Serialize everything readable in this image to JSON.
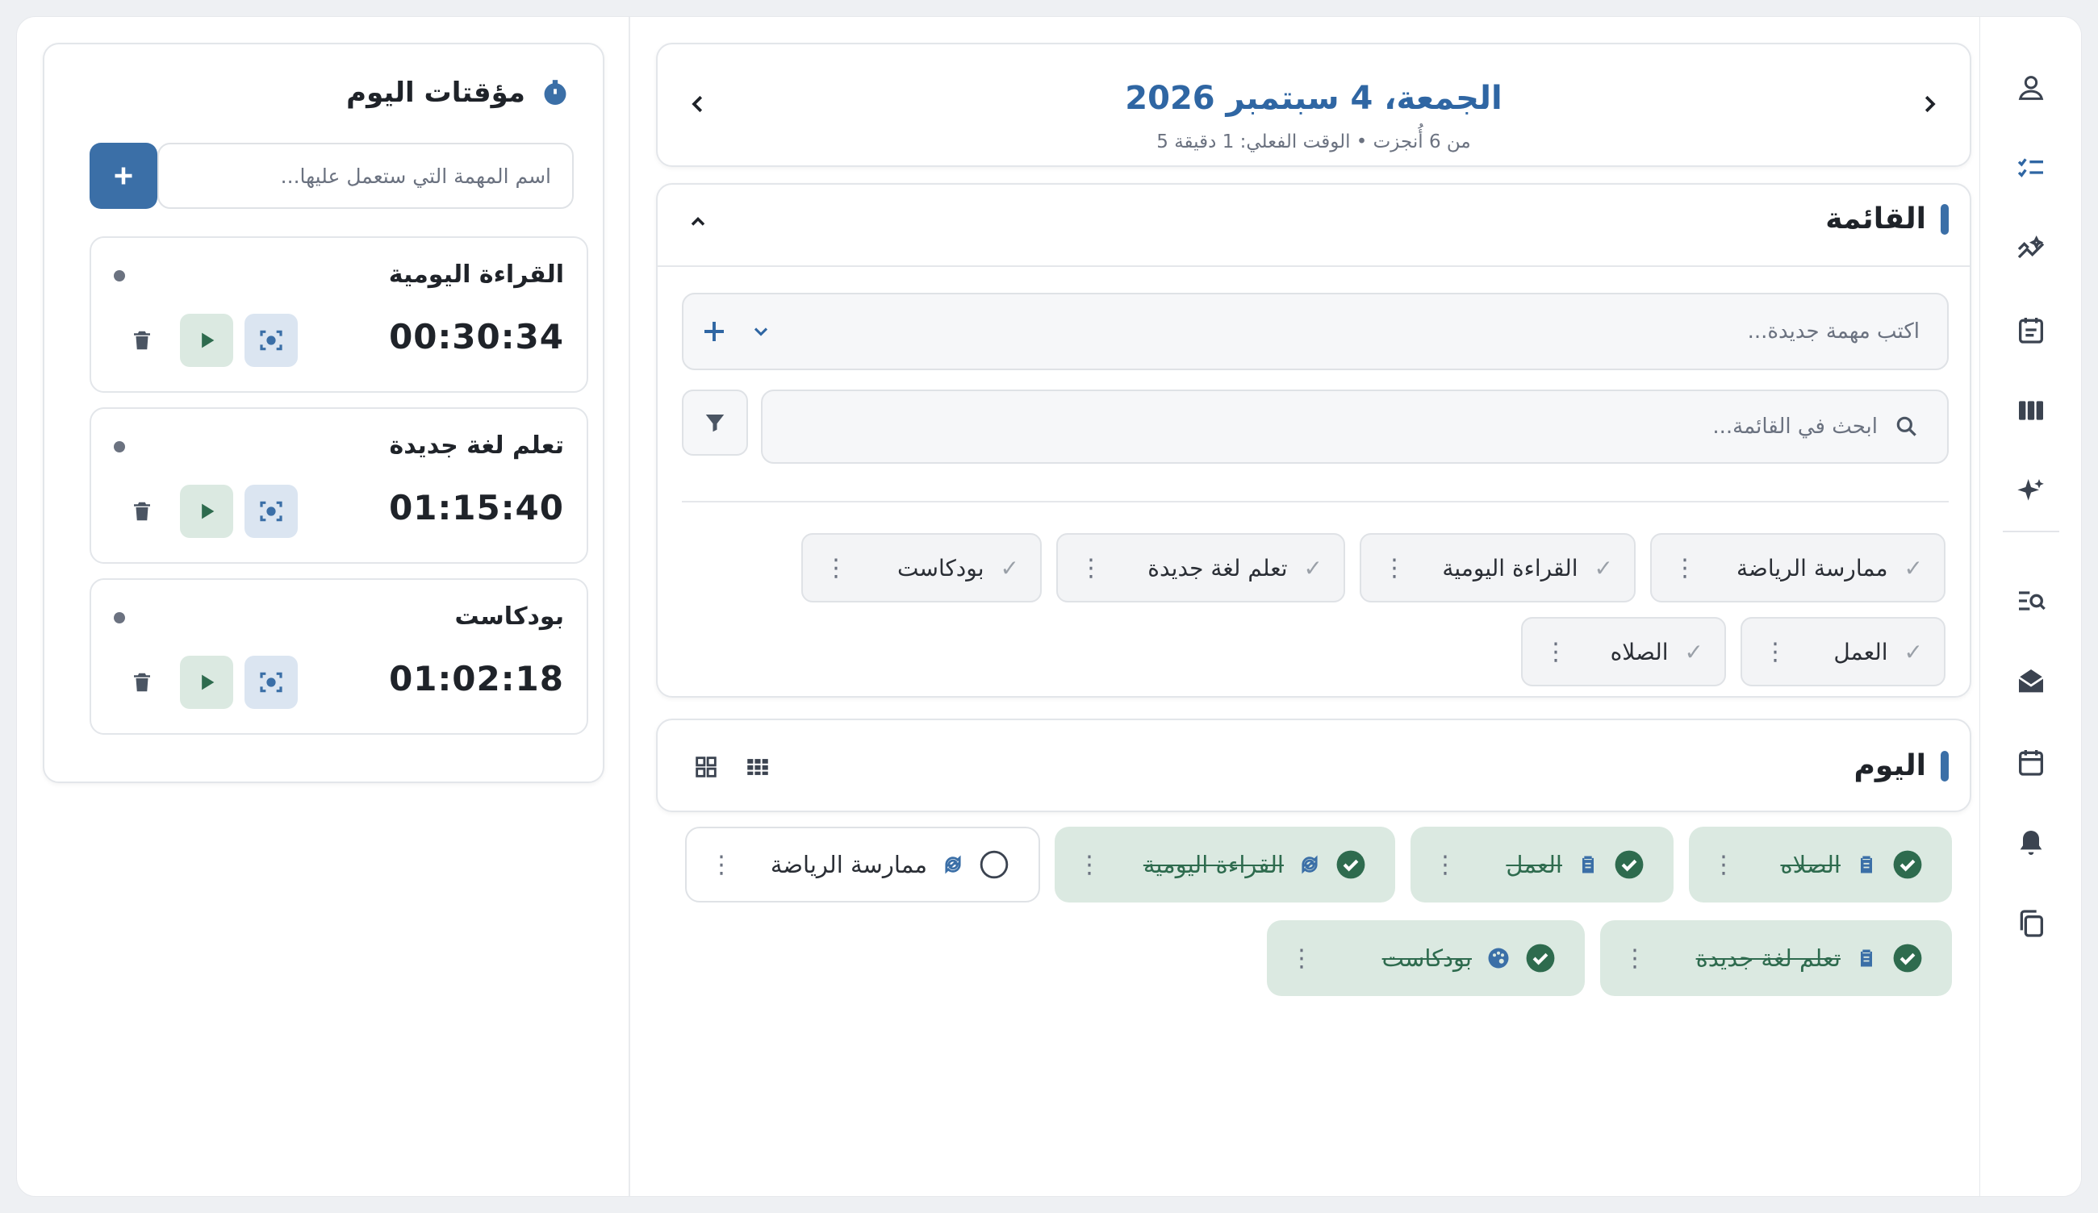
{
  "header": {
    "date_title": "الجمعة، 4 سبتمبر 2026",
    "subtitle": "5 من 6 أُنجزت • الوقت الفعلي: 1 دقيقة"
  },
  "list_section": {
    "title": "القائمة",
    "new_task_placeholder": "اكتب مهمة جديدة...",
    "search_placeholder": "ابحث في القائمة...",
    "chips": [
      {
        "label": "ممارسة الرياضة"
      },
      {
        "label": "القراءة اليومية"
      },
      {
        "label": "تعلم لغة جديدة"
      },
      {
        "label": "بودكاست"
      },
      {
        "label": "العمل"
      },
      {
        "label": "الصلاه"
      }
    ]
  },
  "today_section": {
    "title": "اليوم",
    "tasks": [
      {
        "label": "الصلاه",
        "done": true,
        "icon": "clipboard-icon"
      },
      {
        "label": "العمل",
        "done": true,
        "icon": "clipboard-icon"
      },
      {
        "label": "القراءة اليومية",
        "done": true,
        "icon": "repeat-icon"
      },
      {
        "label": "ممارسة الرياضة",
        "done": false,
        "icon": "repeat-icon"
      },
      {
        "label": "تعلم لغة جديدة",
        "done": true,
        "icon": "clipboard-icon"
      },
      {
        "label": "بودكاست",
        "done": true,
        "icon": "palette-icon"
      }
    ]
  },
  "timers": {
    "title": "مؤقتات اليوم",
    "input_placeholder": "اسم المهمة التي ستعمل عليها...",
    "items": [
      {
        "name": "القراءة اليومية",
        "time": "00:30:34"
      },
      {
        "name": "تعلم لغة جديدة",
        "time": "01:15:40"
      },
      {
        "name": "بودكاست",
        "time": "01:02:18"
      }
    ]
  },
  "colors": {
    "accent": "#3b6fa7",
    "done_bg": "#dbe9e1",
    "done_text": "#2e6b4e"
  }
}
